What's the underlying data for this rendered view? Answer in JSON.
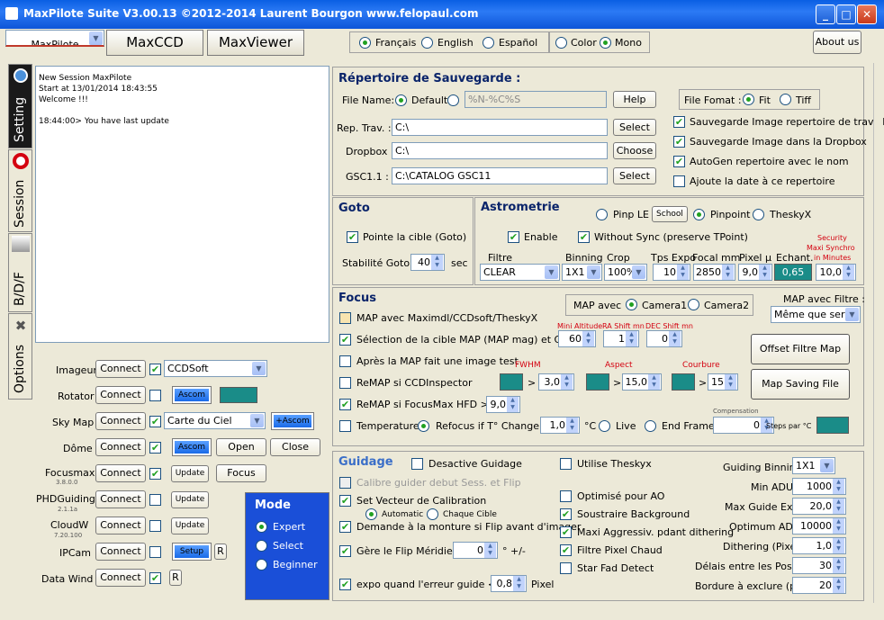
{
  "window": {
    "title": "MaxPilote Suite  V3.00.13  ©2012-2014 Laurent Bourgon  www.felopaul.com"
  },
  "tabs": [
    "MaxPilote",
    "MaxCCD",
    "MaxViewer"
  ],
  "lang": {
    "francais": "Français",
    "english": "English",
    "espanol": "Español",
    "color": "Color",
    "mono": "Mono"
  },
  "about": "About us",
  "side_tabs": [
    "Setting",
    "Session",
    "B/D/F",
    "Options"
  ],
  "log": [
    "New Session MaxPilote",
    "Start at 13/01/2014 18:43:55",
    "Welcome !!!",
    "",
    "18:44:00> You have last update"
  ],
  "devices": {
    "imageur": "Imageur",
    "rotator": "Rotator",
    "skymap": "Sky Map",
    "dome": "Dôme",
    "focusmax": "Focusmax",
    "focusmax_ver": "3.8.0.0",
    "phd": "PHDGuiding",
    "phd_ver": "2.1.1a",
    "cloudw": "CloudW",
    "cloudw_ver": "7.20.100",
    "ipcam": "IPCam",
    "datawind": "Data Wind",
    "connect": "Connect",
    "ccdsoft": "CCDSoft",
    "ascom": "Ascom",
    "carte": "Carte du Ciel",
    "plus_ascom": "+Ascom",
    "open": "Open",
    "close": "Close",
    "update": "Update",
    "focus": "Focus",
    "setup": "Setup",
    "r": "R"
  },
  "mode": {
    "title": "Mode",
    "expert": "Expert",
    "select": "Select",
    "beginner": "Beginner"
  },
  "repertoire": {
    "title": "Répertoire de Sauvegarde :",
    "filename": "File Name:",
    "default": "Default",
    "pattern": "%N-%C%S",
    "help": "Help",
    "filefomat": "File Fomat :",
    "fit": "Fit",
    "tiff": "Tiff",
    "reptrav": "Rep. Trav. :",
    "reptrav_val": "C:\\",
    "dropbox": "Dropbox :",
    "dropbox_val": "C:\\",
    "gsc": "GSC1.1 :",
    "gsc_val": "C:\\CATALOG GSC11",
    "select": "Select",
    "choose": "Choose",
    "cb1": "Sauvegarde Image repertoire de travail",
    "cb2": "Sauvegarde Image dans la  Dropbox",
    "cb3": "AutoGen repertoire avec le nom",
    "cb4": "Ajoute la date à ce repertoire"
  },
  "goto": {
    "title": "Goto",
    "pointe": "Pointe la cible (Goto)",
    "stab": "Stabilité Goto",
    "stab_val": "40",
    "sec": "sec"
  },
  "astro": {
    "title": "Astrometrie",
    "pinple": "Pinp LE",
    "school": "School",
    "pinpoint": "Pinpoint",
    "theskyx": "TheskyX",
    "enable": "Enable",
    "withoutsync": "Without Sync (preserve TPoint)",
    "filtre": "Filtre",
    "binning": "Binning",
    "crop": "Crop",
    "tpsexpo": "Tps Expo",
    "focal": "Focal mm",
    "pixel": "Pixel µ",
    "echant": "Echant.",
    "security": "Security",
    "maxi": "Maxi Synchro",
    "inmin": "in Minutes",
    "filtre_val": "CLEAR",
    "bin_val": "1X1",
    "crop_val": "100%",
    "expo_val": "10",
    "focal_val": "2850",
    "pixel_val": "9,0",
    "echant_val": "0,65",
    "sec_val": "10,0"
  },
  "focus": {
    "title": "Focus",
    "mapavec": "MAP avec",
    "cam1": "Camera1",
    "cam2": "Camera2",
    "mapfiltre": "MAP avec Filtre :",
    "memeserie": "Même que serie",
    "maxim": "MAP avec Maximdl/CCDsoft/TheskyX",
    "selection": "Sélection de la cible MAP (MAP mag) et Goto",
    "minalt": "Mini Altitude",
    "rashift": "RA Shift mn",
    "decshift": "DEC Shift mn",
    "minalt_val": "60",
    "ra_val": "1",
    "dec_val": "0",
    "apres": "Après la MAP fait une image test",
    "fwhm": "FWHM",
    "aspect": "Aspect",
    "courbure": "Courbure",
    "remapccd": "ReMAP si CCDInspector",
    "fwhm_val": "3,0",
    "aspect_val": "15,0",
    "courb_val": "15",
    "remaphfd": "ReMAP si FocusMax HFD >",
    "hfd_val": "9,0",
    "offset": "Offset Filtre Map",
    "mapsaving": "Map Saving File",
    "temp": "Temperature",
    "refocus": "Refocus if  T°  Change",
    "temp_val": "1,0",
    "deg": "°C",
    "live": "Live",
    "endframe": "End Frame",
    "compensation": "Compensation",
    "comp_val": "0",
    "stepspar": "Steps par °C",
    "gt": ">"
  },
  "guidage": {
    "title": "Guidage",
    "desactive": "Desactive Guidage",
    "calibre": "Calibre guider debut Sess. et Flip",
    "setvect": "Set Vecteur de Calibration",
    "auto": "Automatic",
    "chaque": "Chaque Cible",
    "demande": "Demande à la monture si Flip avant d'imager",
    "flip": "Gère le Flip Méridien",
    "flip_val": "0",
    "plusmoins": "° +/-",
    "expo": "expo quand  l'erreur guide <",
    "expo_val": "0,8",
    "pixel": "Pixel",
    "theskyx": "Utilise Theskyx",
    "ao": "Optimisé pour  AO",
    "soustraire": "Soustraire Background",
    "maxiagg": "Maxi Aggressiv. pdant dithering",
    "filtrepix": "Filtre Pixel Chaud",
    "starfad": "Star Fad Detect",
    "binning": "Guiding Binning",
    "bin_val": "1X1",
    "minadu": "Min ADU",
    "minadu_val": "1000",
    "maxexp": "Max Guide Exp",
    "maxexp_val": "20,0",
    "optadu": "Optimum ADU",
    "optadu_val": "10000",
    "dither": "Dithering (Pixel)",
    "dither_val": "1,0",
    "delais": "Délais entre les Poses.",
    "delais_val": "30",
    "bordure": "Bordure à exclure (pix)",
    "bordure_val": "20"
  }
}
